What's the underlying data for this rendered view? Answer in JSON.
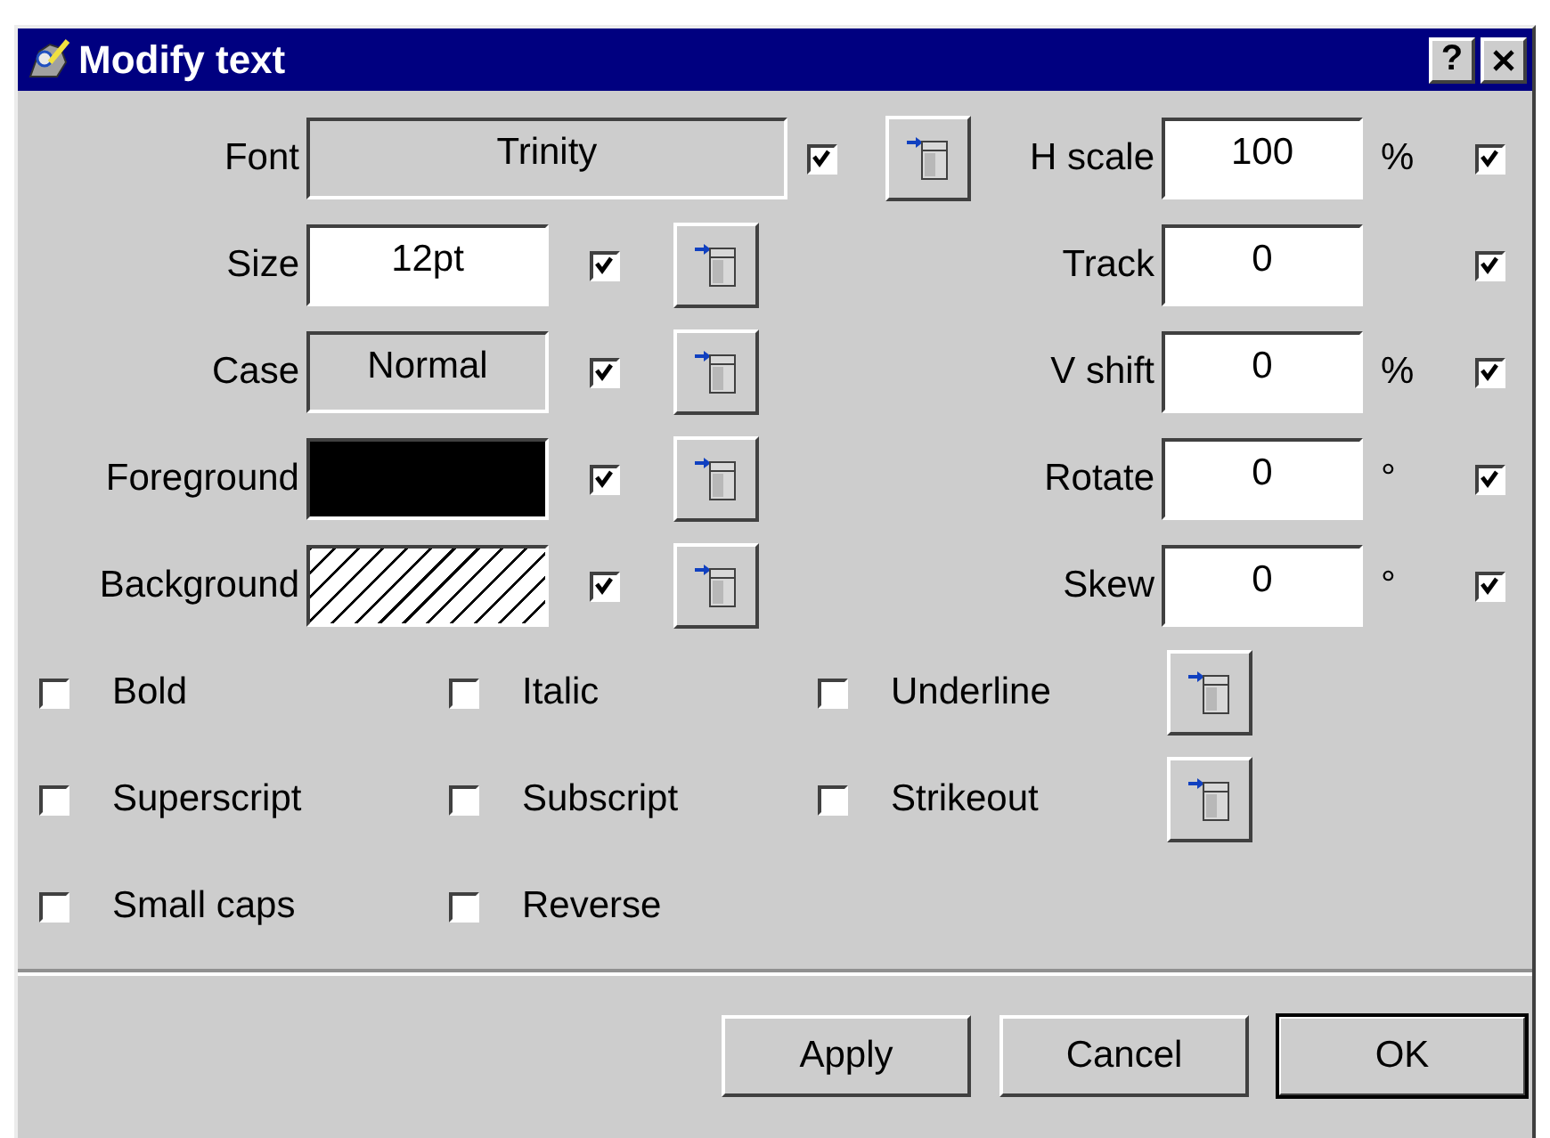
{
  "window": {
    "title": "Modify text",
    "help_button": "?"
  },
  "left_fields": [
    {
      "label": "Font",
      "value": "Trinity",
      "kind": "readonly",
      "checked": true,
      "wide": true
    },
    {
      "label": "Size",
      "value": "12pt",
      "kind": "input",
      "checked": true,
      "wide": false
    },
    {
      "label": "Case",
      "value": "Normal",
      "kind": "readonly",
      "checked": true,
      "wide": false
    },
    {
      "label": "Foreground",
      "kind": "color",
      "color": "#000000",
      "checked": true,
      "wide": false
    },
    {
      "label": "Background",
      "kind": "hatch",
      "checked": true,
      "wide": false
    }
  ],
  "right_fields": [
    {
      "label": "H scale",
      "value": "100",
      "unit": "%",
      "checked": true
    },
    {
      "label": "Track",
      "value": "0",
      "checked": true
    },
    {
      "label": "V shift",
      "value": "0",
      "unit": "%",
      "checked": true
    },
    {
      "label": "Rotate",
      "value": "0",
      "unit": "°",
      "checked": true
    },
    {
      "label": "Skew",
      "value": "0",
      "unit": "°",
      "checked": true
    }
  ],
  "style_rows": [
    {
      "options": [
        {
          "label": "Bold",
          "checked": false
        },
        {
          "label": "Italic",
          "checked": false
        },
        {
          "label": "Underline",
          "checked": false
        }
      ],
      "apply_button": true
    },
    {
      "options": [
        {
          "label": "Superscript",
          "checked": false
        },
        {
          "label": "Subscript",
          "checked": false
        },
        {
          "label": "Strikeout",
          "checked": false
        }
      ],
      "apply_button": true
    },
    {
      "options": [
        {
          "label": "Small caps",
          "checked": false
        },
        {
          "label": "Reverse",
          "checked": false
        }
      ],
      "apply_button": false
    }
  ],
  "buttons": [
    {
      "label": "Apply",
      "default": false
    },
    {
      "label": "Cancel",
      "default": false
    },
    {
      "label": "OK",
      "default": true
    }
  ]
}
